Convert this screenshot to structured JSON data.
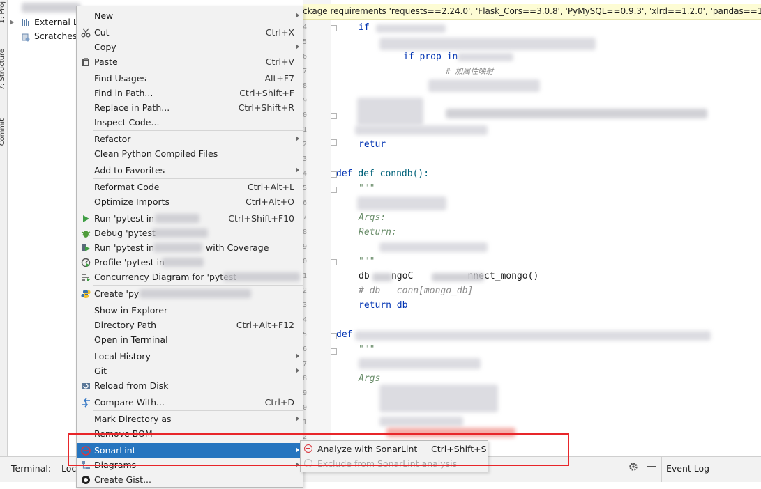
{
  "left_stripe": {
    "tab1": "1: Proj",
    "tab2": "7: Structure",
    "tab3": "Commit"
  },
  "project_tree": [
    {
      "label": "External Li",
      "icon": "library-icon"
    },
    {
      "label": "Scratches",
      "icon": "scratches-icon"
    }
  ],
  "project_header_snippet": "",
  "notice_bar": {
    "text": "ckage requirements 'requests==2.24.0', 'Flask_Cors==3.0.8', 'PyMySQL==0.9.3', 'xlrd==1.2.0', 'pandas==1.0.5', '"
  },
  "editor": {
    "line_numbers": [
      "4",
      "5",
      "6",
      "7",
      "8",
      "9",
      "0",
      "1",
      "2",
      "3",
      "4",
      "5",
      "6",
      "7",
      "8",
      "9",
      "0",
      "1",
      "2",
      "3",
      "4",
      "5",
      "6",
      "7",
      "8",
      "9",
      "0",
      "1",
      "2",
      "3"
    ],
    "code": {
      "l_if": "if",
      "l_if_prop": "if prop in",
      "l_comment_cn": "# 加属性映射",
      "l_return1": "retur",
      "l_def_conndb": "def conndb():",
      "l_doc_open": "\"\"\"",
      "l_args": "Args:",
      "l_return_doc": "Return:",
      "l_doc_close": "\"\"\"",
      "l_db_assign": "db    ngoC          nnect_mongo()",
      "l_comment_db": "# db   conn[mongo_db]",
      "l_return_db": "return db",
      "l_def2": "def",
      "l_doc_open2": "\"\"\"",
      "l_args2": "Args"
    }
  },
  "bottom_bar": {
    "terminal": "Terminal:",
    "local": "Loc",
    "event_log": "Event Log"
  },
  "context_menu": {
    "items": [
      {
        "label": "New",
        "shortcut": "",
        "submenu": true,
        "icon": ""
      },
      {
        "label": "Cut",
        "shortcut": "Ctrl+X",
        "submenu": false,
        "icon": "scissors-icon"
      },
      {
        "label": "Copy",
        "shortcut": "",
        "submenu": true,
        "icon": ""
      },
      {
        "label": "Paste",
        "shortcut": "Ctrl+V",
        "submenu": false,
        "icon": "clipboard-icon"
      },
      {
        "label": "Find Usages",
        "shortcut": "Alt+F7",
        "submenu": false,
        "icon": ""
      },
      {
        "label": "Find in Path...",
        "shortcut": "Ctrl+Shift+F",
        "submenu": false,
        "icon": ""
      },
      {
        "label": "Replace in Path...",
        "shortcut": "Ctrl+Shift+R",
        "submenu": false,
        "icon": ""
      },
      {
        "label": "Inspect Code...",
        "shortcut": "",
        "submenu": false,
        "icon": ""
      },
      {
        "label": "Refactor",
        "shortcut": "",
        "submenu": true,
        "icon": ""
      },
      {
        "label": "Clean Python Compiled Files",
        "shortcut": "",
        "submenu": false,
        "icon": ""
      },
      {
        "label": "Add to Favorites",
        "shortcut": "",
        "submenu": true,
        "icon": ""
      },
      {
        "label": "Reformat Code",
        "shortcut": "Ctrl+Alt+L",
        "submenu": false,
        "icon": ""
      },
      {
        "label": "Optimize Imports",
        "shortcut": "Ctrl+Alt+O",
        "submenu": false,
        "icon": ""
      },
      {
        "label": "Run 'pytest in",
        "shortcut": "Ctrl+Shift+F10",
        "submenu": false,
        "icon": "run-icon"
      },
      {
        "label": "Debug 'pytest",
        "shortcut": "",
        "submenu": false,
        "icon": "debug-icon"
      },
      {
        "label": "Run 'pytest in",
        "suffix": "with Coverage",
        "shortcut": "",
        "submenu": false,
        "icon": "coverage-icon"
      },
      {
        "label": "Profile 'pytest in",
        "shortcut": "",
        "submenu": false,
        "icon": "profile-icon"
      },
      {
        "label": "Concurrency Diagram for 'pytest",
        "shortcut": "",
        "submenu": false,
        "icon": "concurrency-icon"
      },
      {
        "label": "Create 'py",
        "shortcut": "",
        "submenu": false,
        "icon": "python-icon"
      },
      {
        "label": "Show in Explorer",
        "shortcut": "",
        "submenu": false,
        "icon": ""
      },
      {
        "label": "Directory Path",
        "shortcut": "Ctrl+Alt+F12",
        "submenu": false,
        "icon": ""
      },
      {
        "label": "Open in Terminal",
        "shortcut": "",
        "submenu": false,
        "icon": "terminal-icon"
      },
      {
        "label": "Local History",
        "shortcut": "",
        "submenu": true,
        "icon": ""
      },
      {
        "label": "Git",
        "shortcut": "",
        "submenu": true,
        "icon": ""
      },
      {
        "label": "Reload from Disk",
        "shortcut": "",
        "submenu": false,
        "icon": "reload-icon"
      },
      {
        "label": "Compare With...",
        "shortcut": "Ctrl+D",
        "submenu": false,
        "icon": "compare-icon"
      },
      {
        "label": "Mark Directory as",
        "shortcut": "",
        "submenu": true,
        "icon": ""
      },
      {
        "label": "Remove BOM",
        "shortcut": "",
        "submenu": false,
        "icon": ""
      },
      {
        "label": "SonarLint",
        "shortcut": "",
        "submenu": true,
        "icon": "sonarlint-icon",
        "selected": true
      },
      {
        "label": "Diagrams",
        "shortcut": "",
        "submenu": true,
        "icon": "diagrams-icon"
      },
      {
        "label": "Create Gist...",
        "shortcut": "",
        "submenu": false,
        "icon": "github-icon"
      }
    ]
  },
  "sonar_submenu": {
    "items": [
      {
        "label": "Analyze with SonarLint",
        "shortcut": "Ctrl+Shift+S",
        "enabled": true
      },
      {
        "label": "Exclude from SonarLint analysis",
        "shortcut": "",
        "enabled": false
      }
    ]
  },
  "colors": {
    "selection": "#2675bf",
    "highlight_box": "#e8262a",
    "sonar_red": "#d9363e",
    "notice_bg": "#fdfcd4"
  }
}
